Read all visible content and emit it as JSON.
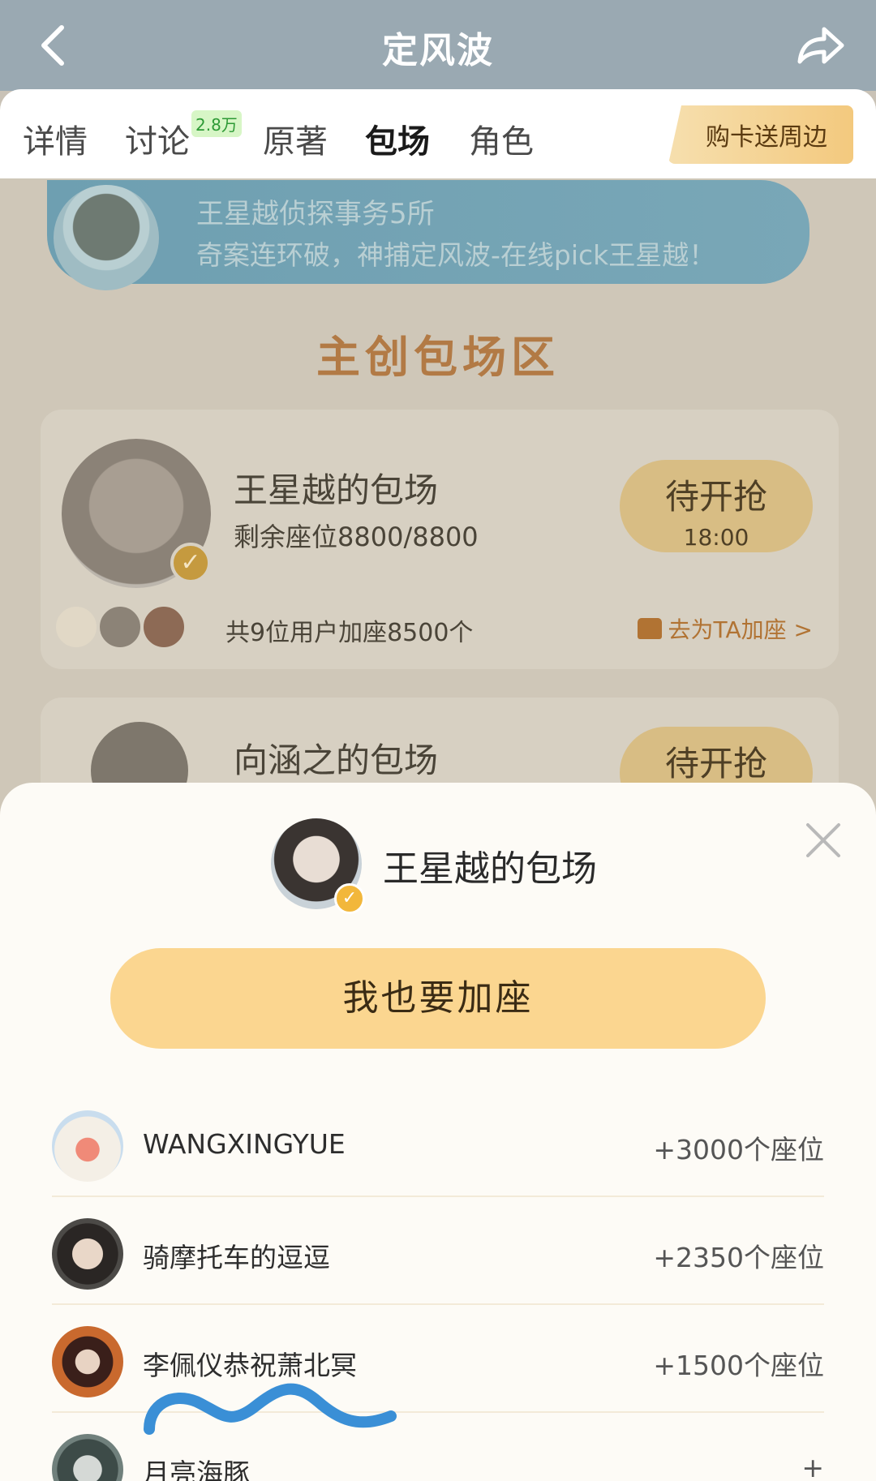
{
  "header": {
    "title": "定风波",
    "back_icon": "chevron-left-icon",
    "share_icon": "share-arrow-icon"
  },
  "tabs": [
    {
      "label": "详情",
      "active": false
    },
    {
      "label": "讨论",
      "badge": "2.8万",
      "active": false
    },
    {
      "label": "原著",
      "active": false
    },
    {
      "label": "包场",
      "active": true
    },
    {
      "label": "角色",
      "active": false
    }
  ],
  "promo_button": "购卡送周边",
  "banner": {
    "line1": "王星越侦探事务5所",
    "line2": "奇案连环破，神捕定风波-在线pick王星越！"
  },
  "section_title": "主创包场区",
  "cards": [
    {
      "name": "王星越的包场",
      "seats": "剩余座位8800/8800",
      "state": "待开抢",
      "time": "18:00",
      "summary": "共9位用户加座8500个",
      "add_link": "去为TA加座 >"
    },
    {
      "name": "向涵之的包场",
      "state": "待开抢"
    }
  ],
  "sheet": {
    "title": "王星越的包场",
    "join_button": "我也要加座",
    "close_icon": "close-icon",
    "users": [
      {
        "name": "WANGXINGYUE",
        "count": "+3000个座位"
      },
      {
        "name": "骑摩托车的逗逗",
        "count": "+2350个座位"
      },
      {
        "name": "李佩仪恭祝萧北冥",
        "count": "+1500个座位"
      },
      {
        "name": "月亮海豚",
        "count": "+"
      }
    ]
  },
  "colors": {
    "accent": "#fbd690",
    "topbar": "#9aa9b2",
    "link": "#b17333",
    "scribble": "#3a8fd6"
  }
}
